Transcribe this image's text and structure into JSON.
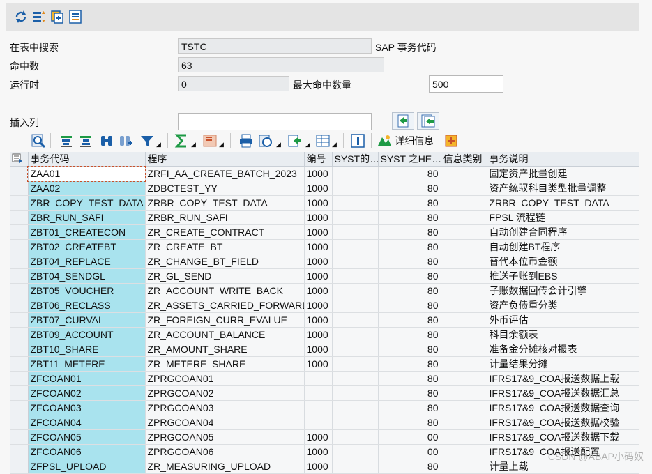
{
  "toolbar_icons": [
    "refresh-icon",
    "filter-icon",
    "copy-icon",
    "list-icon"
  ],
  "form": {
    "search_label": "在表中搜索",
    "search_value": "TSTC",
    "search_desc": "SAP 事务代码",
    "hits_label": "命中数",
    "hits_value": "63",
    "runtime_label": "运行时",
    "runtime_value": "0",
    "max_hits_label": "最大命中数量",
    "max_hits_value": "500",
    "insert_col_label": "插入列",
    "insert_col_value": ""
  },
  "alv": {
    "detail_label": "详细信息",
    "columns": [
      "事务代码",
      "程序",
      "编号",
      "SYST的…",
      "SYST 之HE…",
      "信息类别",
      "事务说明"
    ],
    "rows": [
      [
        "ZAA01",
        "ZRFI_AA_CREATE_BATCH_2023",
        "1000",
        "",
        "80",
        "",
        "固定资产批量创建"
      ],
      [
        "ZAA02",
        "ZDBCTEST_YY",
        "1000",
        "",
        "80",
        "",
        "资产统驭科目类型批量调整"
      ],
      [
        "ZBR_COPY_TEST_DATA",
        "ZRBR_COPY_TEST_DATA",
        "1000",
        "",
        "80",
        "",
        "ZRBR_COPY_TEST_DATA"
      ],
      [
        "ZBR_RUN_SAFI",
        "ZRBR_RUN_SAFI",
        "1000",
        "",
        "80",
        "",
        "FPSL 流程链"
      ],
      [
        "ZBT01_CREATECON",
        "ZR_CREATE_CONTRACT",
        "1000",
        "",
        "80",
        "",
        "自动创建合同程序"
      ],
      [
        "ZBT02_CREATEBT",
        "ZR_CREATE_BT",
        "1000",
        "",
        "80",
        "",
        "自动创建BT程序"
      ],
      [
        "ZBT04_REPLACE",
        "ZR_CHANGE_BT_FIELD",
        "1000",
        "",
        "80",
        "",
        "替代本位币金额"
      ],
      [
        "ZBT04_SENDGL",
        "ZR_GL_SEND",
        "1000",
        "",
        "80",
        "",
        "推送子账到EBS"
      ],
      [
        "ZBT05_VOUCHER",
        "ZR_ACCOUNT_WRITE_BACK",
        "1000",
        "",
        "80",
        "",
        "子账数据回传会计引擎"
      ],
      [
        "ZBT06_RECLASS",
        "ZR_ASSETS_CARRIED_FORWARD",
        "1000",
        "",
        "80",
        "",
        "资产负债重分类"
      ],
      [
        "ZBT07_CURVAL",
        "ZR_FOREIGN_CURR_EVALUE",
        "1000",
        "",
        "80",
        "",
        "外币评估"
      ],
      [
        "ZBT09_ACCOUNT",
        "ZR_ACCOUNT_BALANCE",
        "1000",
        "",
        "80",
        "",
        "科目余额表"
      ],
      [
        "ZBT10_SHARE",
        "ZR_AMOUNT_SHARE",
        "1000",
        "",
        "80",
        "",
        "准备金分摊核对报表"
      ],
      [
        "ZBT11_METERE",
        "ZR_METERE_SHARE",
        "1000",
        "",
        "80",
        "",
        "计量结果分摊"
      ],
      [
        "ZFCOAN01",
        "ZPRGCOAN01",
        "",
        "",
        "80",
        "",
        "IFRS17&9_COA报送数据上载"
      ],
      [
        "ZFCOAN02",
        "ZPRGCOAN02",
        "",
        "",
        "80",
        "",
        "IFRS17&9_COA报送数据汇总"
      ],
      [
        "ZFCOAN03",
        "ZPRGCOAN03",
        "",
        "",
        "80",
        "",
        "IFRS17&9_COA报送数据查询"
      ],
      [
        "ZFCOAN04",
        "ZPRGCOAN04",
        "",
        "",
        "80",
        "",
        "IFRS17&9_COA报送数据校验"
      ],
      [
        "ZFCOAN05",
        "ZPRGCOAN05",
        "1000",
        "",
        "00",
        "",
        "IFRS17&9_COA报送数据下载"
      ],
      [
        "ZFCOAN06",
        "ZPRGCOAN06",
        "1000",
        "",
        "00",
        "",
        "IFRS17&9_COA报送配置"
      ],
      [
        "ZFPSL_UPLOAD",
        "ZR_MEASURING_UPLOAD",
        "1000",
        "",
        "80",
        "",
        "计量上载"
      ]
    ]
  },
  "watermark": "CSDN @ABAP小码奴"
}
